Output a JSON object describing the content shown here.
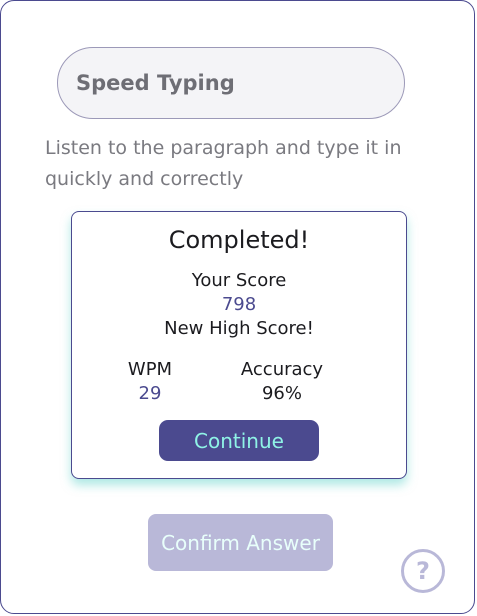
{
  "app": {
    "title": "Speed Typing",
    "instructions": "Listen to the paragraph and type it in quickly and correctly"
  },
  "result": {
    "heading": "Completed!",
    "score_label": "Your Score",
    "score_value": "798",
    "high_score_text": "New High Score!",
    "wpm_label": "WPM",
    "wpm_value": "29",
    "accuracy_label": "Accuracy",
    "accuracy_value": "96%",
    "continue_label": "Continue"
  },
  "footer": {
    "confirm_label": "Confirm Answer",
    "confirm_disabled": true,
    "help_glyph": "?",
    "help_icon": "question-mark-icon"
  },
  "colors": {
    "accent": "#4b4a8f",
    "accent_text": "#8ff3e6",
    "disabled": "#b9b8d8",
    "glow": "#6bd6ce"
  }
}
